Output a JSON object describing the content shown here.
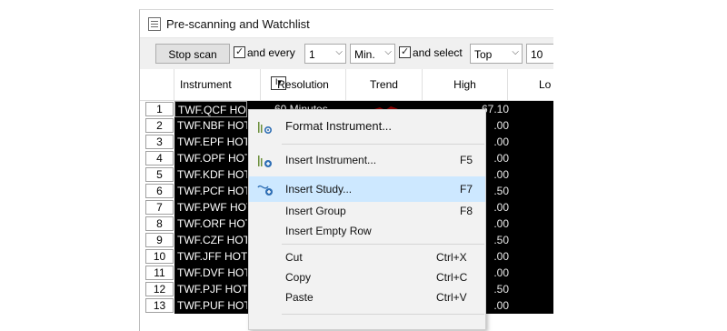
{
  "window": {
    "title": "Pre-scanning and Watchlist"
  },
  "toolbar": {
    "stop_scan": "Stop scan",
    "and_every_label": "and every",
    "interval_value": "1",
    "unit_value": "Min.",
    "and_select_label": "and select",
    "select_value": "Top",
    "count_value": "10"
  },
  "grid": {
    "headers": {
      "instrument": "Instrument",
      "resolution": "Resolution",
      "trend": "Trend",
      "high": "High",
      "low": "Lo"
    },
    "rows": [
      {
        "num": "1",
        "name": "TWF.QCF HOT",
        "resolution": "60 Minutes",
        "high": "67.10"
      },
      {
        "num": "2",
        "name": "TWF.NBF HOT",
        "high": ".00"
      },
      {
        "num": "3",
        "name": "TWF.EPF HOT",
        "high": ".00"
      },
      {
        "num": "4",
        "name": "TWF.OPF HOT",
        "high": ".00"
      },
      {
        "num": "5",
        "name": "TWF.KDF HOT",
        "high": ".00"
      },
      {
        "num": "6",
        "name": "TWF.PCF HOT",
        "high": ".50"
      },
      {
        "num": "7",
        "name": "TWF.PWF HOT",
        "high": ".00"
      },
      {
        "num": "8",
        "name": "TWF.ORF HOT",
        "high": ".00"
      },
      {
        "num": "9",
        "name": "TWF.CZF HOT",
        "high": ".50"
      },
      {
        "num": "10",
        "name": "TWF.JFF HOT",
        "high": ".00"
      },
      {
        "num": "11",
        "name": "TWF.DVF HOT",
        "high": ".00"
      },
      {
        "num": "12",
        "name": "TWF.PJF HOT",
        "high": ".50"
      },
      {
        "num": "13",
        "name": "TWF.PUF HOT",
        "high": ".00"
      }
    ]
  },
  "context_menu": {
    "format_instrument": "Format Instrument...",
    "insert_instrument": "Insert Instrument...",
    "insert_instrument_shortcut": "F5",
    "insert_study": "Insert Study...",
    "insert_study_shortcut": "F7",
    "insert_group": "Insert Group",
    "insert_group_shortcut": "F8",
    "insert_empty_row": "Insert Empty Row",
    "cut": "Cut",
    "cut_shortcut": "Ctrl+X",
    "copy": "Copy",
    "copy_shortcut": "Ctrl+C",
    "paste": "Paste",
    "paste_shortcut": "Ctrl+V"
  },
  "colors": {
    "row_background": "#000000",
    "menu_highlight": "#cde8ff",
    "trend_red": "#8b0000",
    "icon_blue": "#2f6fb5"
  }
}
